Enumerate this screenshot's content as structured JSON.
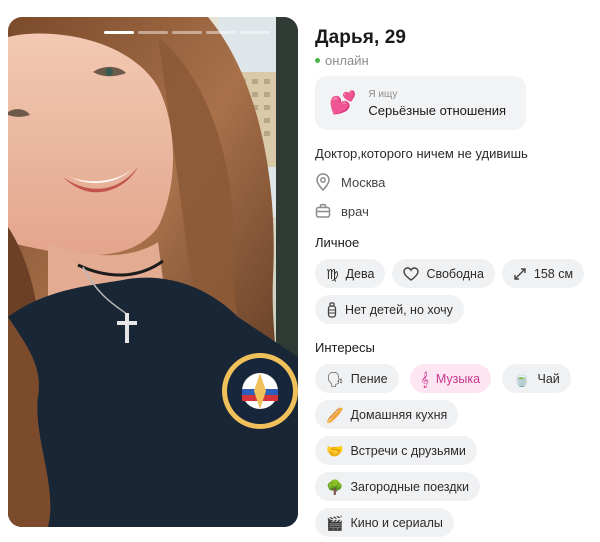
{
  "profile": {
    "name_age": "Дарья, 29",
    "status": "онлайн",
    "seeking": {
      "label": "Я ищу",
      "value": "Серьёзные отношения",
      "icon": "hearts-emoji"
    },
    "bio": "Доктор,которого ничем не удивишь",
    "city": "Москва",
    "job": "врач"
  },
  "photo": {
    "pages": 5,
    "active_page": 1
  },
  "personal": {
    "title": "Личное",
    "tags": [
      {
        "label": "Дева",
        "icon": "virgo-icon"
      },
      {
        "label": "Свободна",
        "icon": "heart-outline-icon"
      },
      {
        "label": "158 см",
        "icon": "height-arrows-icon"
      },
      {
        "label": "Нет детей, но хочу",
        "icon": "bottle-icon"
      }
    ]
  },
  "interests": {
    "title": "Интересы",
    "tags": [
      {
        "label": "Пение",
        "icon": "singing-emoji"
      },
      {
        "label": "Музыка",
        "icon": "music-note-emoji",
        "selected": true
      },
      {
        "label": "Чай",
        "icon": "tea-emoji"
      },
      {
        "label": "Домашняя кухня",
        "icon": "bread-emoji"
      },
      {
        "label": "Встречи с друзьями",
        "icon": "handshake-emoji"
      },
      {
        "label": "Загородные поездки",
        "icon": "tree-emoji"
      },
      {
        "label": "Кино и сериалы",
        "icon": "clapper-emoji"
      }
    ]
  },
  "colors": {
    "online": "#4bb34b",
    "accent_pink": "#c9378b",
    "chip_bg": "#f0f1f3"
  }
}
